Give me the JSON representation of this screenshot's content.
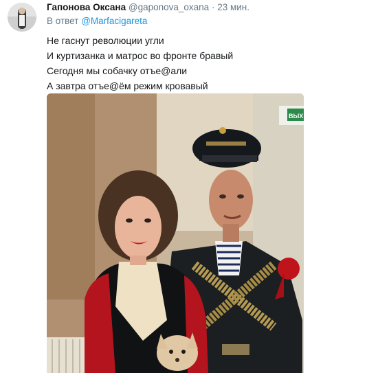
{
  "tweet": {
    "author_name": "Гапонова Оксана",
    "author_handle": "@gaponova_oxana",
    "separator": "·",
    "timestamp": "23 мин.",
    "reply_prefix": "В ответ",
    "reply_handle": "@Marfacigareta",
    "lines": [
      "Не гаснут революции угли",
      "И куртизанка и матрос во фронте бравый",
      "Сегодня мы собачку отъе@али",
      "А завтра отъе@ём режим кровавый"
    ],
    "media": {
      "exit_sign": "ВЫХ"
    }
  },
  "colors": {
    "link": "#1b95e0",
    "secondary_text": "#657786",
    "primary_text": "#14171a"
  },
  "icons": {
    "avatar": "avatar-photo"
  }
}
